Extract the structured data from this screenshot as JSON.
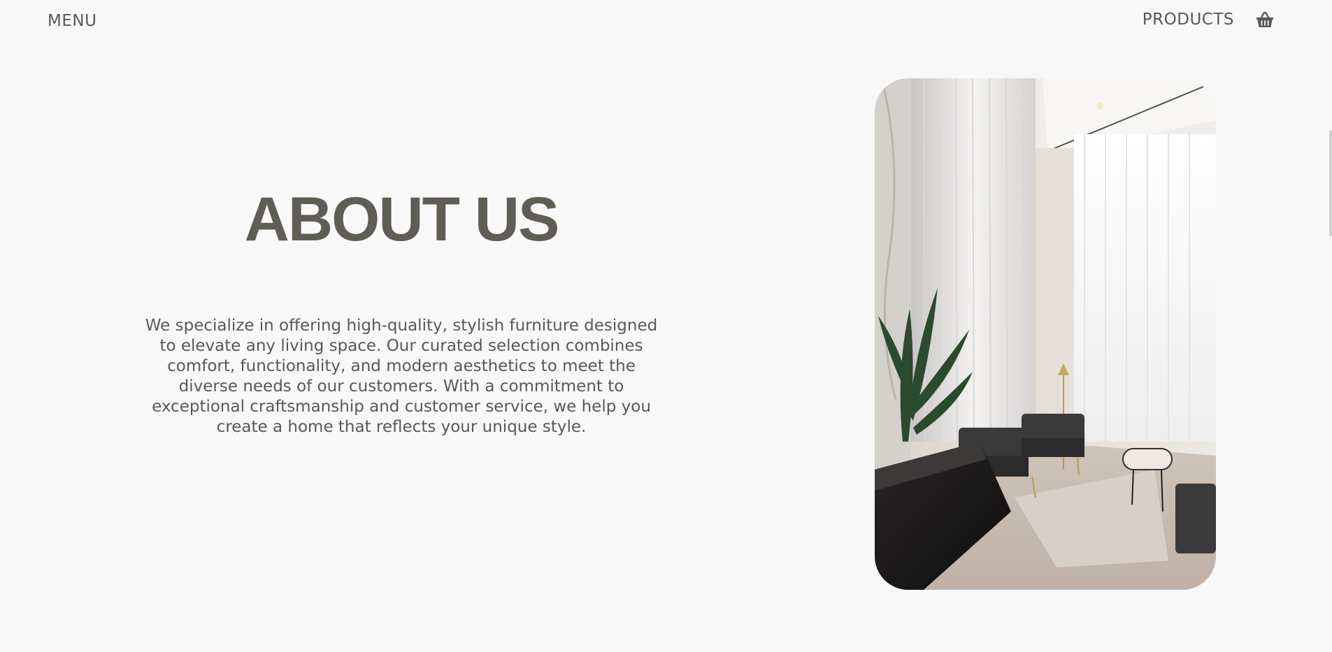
{
  "nav": {
    "menu_label": "MENU",
    "products_label": "PRODUCTS",
    "cart_icon": "basket-icon"
  },
  "about": {
    "title": "ABOUT US",
    "body": "We specialize in offering high-quality, stylish furniture designed to elevate any living space. Our curated selection combines comfort, functionality, and modern aesthetics to meet the diverse needs of our customers. With a commitment to exceptional craftsmanship and customer service, we help you create a home that reflects your unique style."
  },
  "colors": {
    "background": "#f8f8f8",
    "text": "#5e5c55"
  }
}
